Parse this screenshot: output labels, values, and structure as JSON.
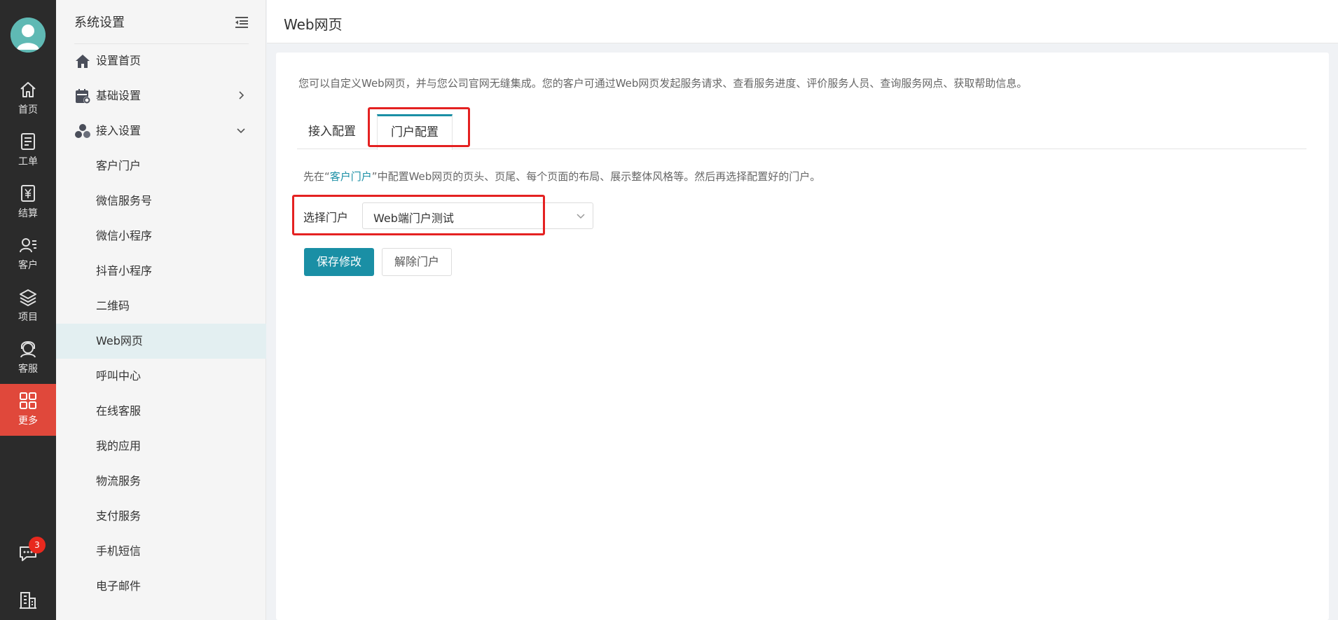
{
  "rail": {
    "items": [
      {
        "label": "首页",
        "icon": "home-icon"
      },
      {
        "label": "工单",
        "icon": "ticket-icon"
      },
      {
        "label": "结算",
        "icon": "settlement-icon"
      },
      {
        "label": "客户",
        "icon": "customer-icon"
      },
      {
        "label": "项目",
        "icon": "project-icon"
      },
      {
        "label": "客服",
        "icon": "service-icon"
      },
      {
        "label": "更多",
        "icon": "more-icon",
        "active": true
      }
    ],
    "chat_badge": "3"
  },
  "submenu": {
    "title": "系统设置",
    "sections": [
      {
        "label": "设置首页",
        "icon": "home-icon"
      },
      {
        "label": "基础设置",
        "icon": "calendar-settings-icon"
      },
      {
        "label": "接入设置",
        "icon": "connect-icon"
      }
    ],
    "items": [
      "客户门户",
      "微信服务号",
      "微信小程序",
      "抖音小程序",
      "二维码",
      "Web网页",
      "呼叫中心",
      "在线客服",
      "我的应用",
      "物流服务",
      "支付服务",
      "手机短信",
      "电子邮件"
    ],
    "active_item": "Web网页"
  },
  "page": {
    "title": "Web网页",
    "description": "您可以自定义Web网页，并与您公司官网无缝集成。您的客户可通过Web网页发起服务请求、查看服务进度、评价服务人员、查询服务网点、获取帮助信息。",
    "tabs": [
      {
        "label": "接入配置"
      },
      {
        "label": "门户配置",
        "active": true
      }
    ],
    "note_prefix": "先在“",
    "note_link": "客户门户",
    "note_suffix": "”中配置Web网页的页头、页尾、每个页面的布局、展示整体风格等。然后再选择配置好的门户。",
    "field_label": "选择门户",
    "select_value": "Web端门户测试",
    "save_label": "保存修改",
    "unbind_label": "解除门户"
  },
  "colors": {
    "accent": "#1a8fa5",
    "rail_bg": "#2b2b2b",
    "rail_active": "#e0483b",
    "highlight": "#e42121"
  }
}
